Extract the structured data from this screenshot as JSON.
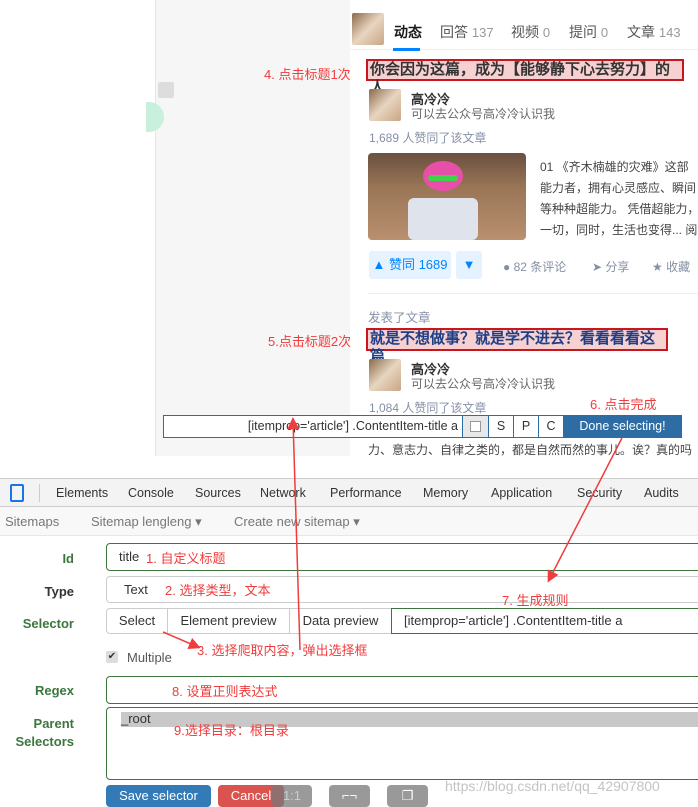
{
  "profile_tabs": [
    {
      "label": "动态",
      "count": ""
    },
    {
      "label": "回答",
      "count": "137"
    },
    {
      "label": "视频",
      "count": "0"
    },
    {
      "label": "提问",
      "count": "0"
    },
    {
      "label": "文章",
      "count": "143"
    }
  ],
  "feed": {
    "item1": {
      "title": "你会因为这篇，成为【能够静下心去努力】的人",
      "author": "高冷冷",
      "bio": "可以去公众号高冷冷认识我",
      "votes_text": "1,689 人赞同了该文章",
      "excerpt": [
        "01 《齐木楠雄的灾难》这部",
        "能力者，拥有心灵感应、瞬间",
        "等种种超能力。 凭借超能力，",
        "一切，同时，生活也变得... 阅"
      ],
      "vote_label": "▲ 赞同 1689",
      "comments": "82 条评论",
      "share": "分享",
      "favorite": "收藏"
    },
    "item2": {
      "action": "发表了文章",
      "title": "就是不想做事？就是学不进去？看看看看这篇",
      "author": "高冷冷",
      "bio": "可以去公众号高冷冷认识我",
      "votes_text": "1,084 人赞同了该文章",
      "excerpt_tail": "力、意志力、自律之类的，都是自然而然的事儿。诶？真的吗"
    }
  },
  "selection_bar": {
    "selector": "[itemprop='article'] .ContentItem-title a",
    "s": "S",
    "p": "P",
    "c": "C",
    "done": "Done selecting!"
  },
  "devtools": {
    "tabs": [
      "Elements",
      "Console",
      "Sources",
      "Network",
      "Performance",
      "Memory",
      "Application",
      "Security",
      "Audits"
    ]
  },
  "scraper_nav": {
    "sitemaps": "Sitemaps",
    "sitemap": "Sitemap lengleng ▾",
    "create": "Create new sitemap ▾"
  },
  "form": {
    "id_label": "Id",
    "id_value": "title",
    "type_label": "Type",
    "type_value": "Text",
    "selector_label": "Selector",
    "select_btn": "Select",
    "element_preview_btn": "Element preview",
    "data_preview_btn": "Data preview",
    "selector_value": "[itemprop='article'] .ContentItem-title a",
    "multiple_label": "Multiple",
    "multiple_checked": true,
    "regex_label": "Regex",
    "regex_value": "",
    "parent_label_1": "Parent",
    "parent_label_2": "Selectors",
    "parent_value": "_root",
    "save": "Save selector",
    "cancel": "Cancel",
    "extra_btn": "1:1"
  },
  "annotations": {
    "a1": "1. 自定义标题",
    "a2": "2. 选择类型，文本",
    "a3": "3. 选择爬取内容，弹出选择框",
    "a4": "4. 点击标题1次",
    "a5": "5.点击标题2次",
    "a6": "6. 点击完成",
    "a7": "7. 生成规则",
    "a8": "8. 设置正则表达式",
    "a9": "9.选择目录：根目录"
  },
  "watermark": "https://blog.csdn.net/qq_42907800",
  "colors": {
    "annotation": "#f03c3c",
    "highlight_border": "#c8161d",
    "done_button": "#2d6da3",
    "save": "#337ab7",
    "cancel": "#d9534f",
    "label_green": "#3c763d"
  }
}
